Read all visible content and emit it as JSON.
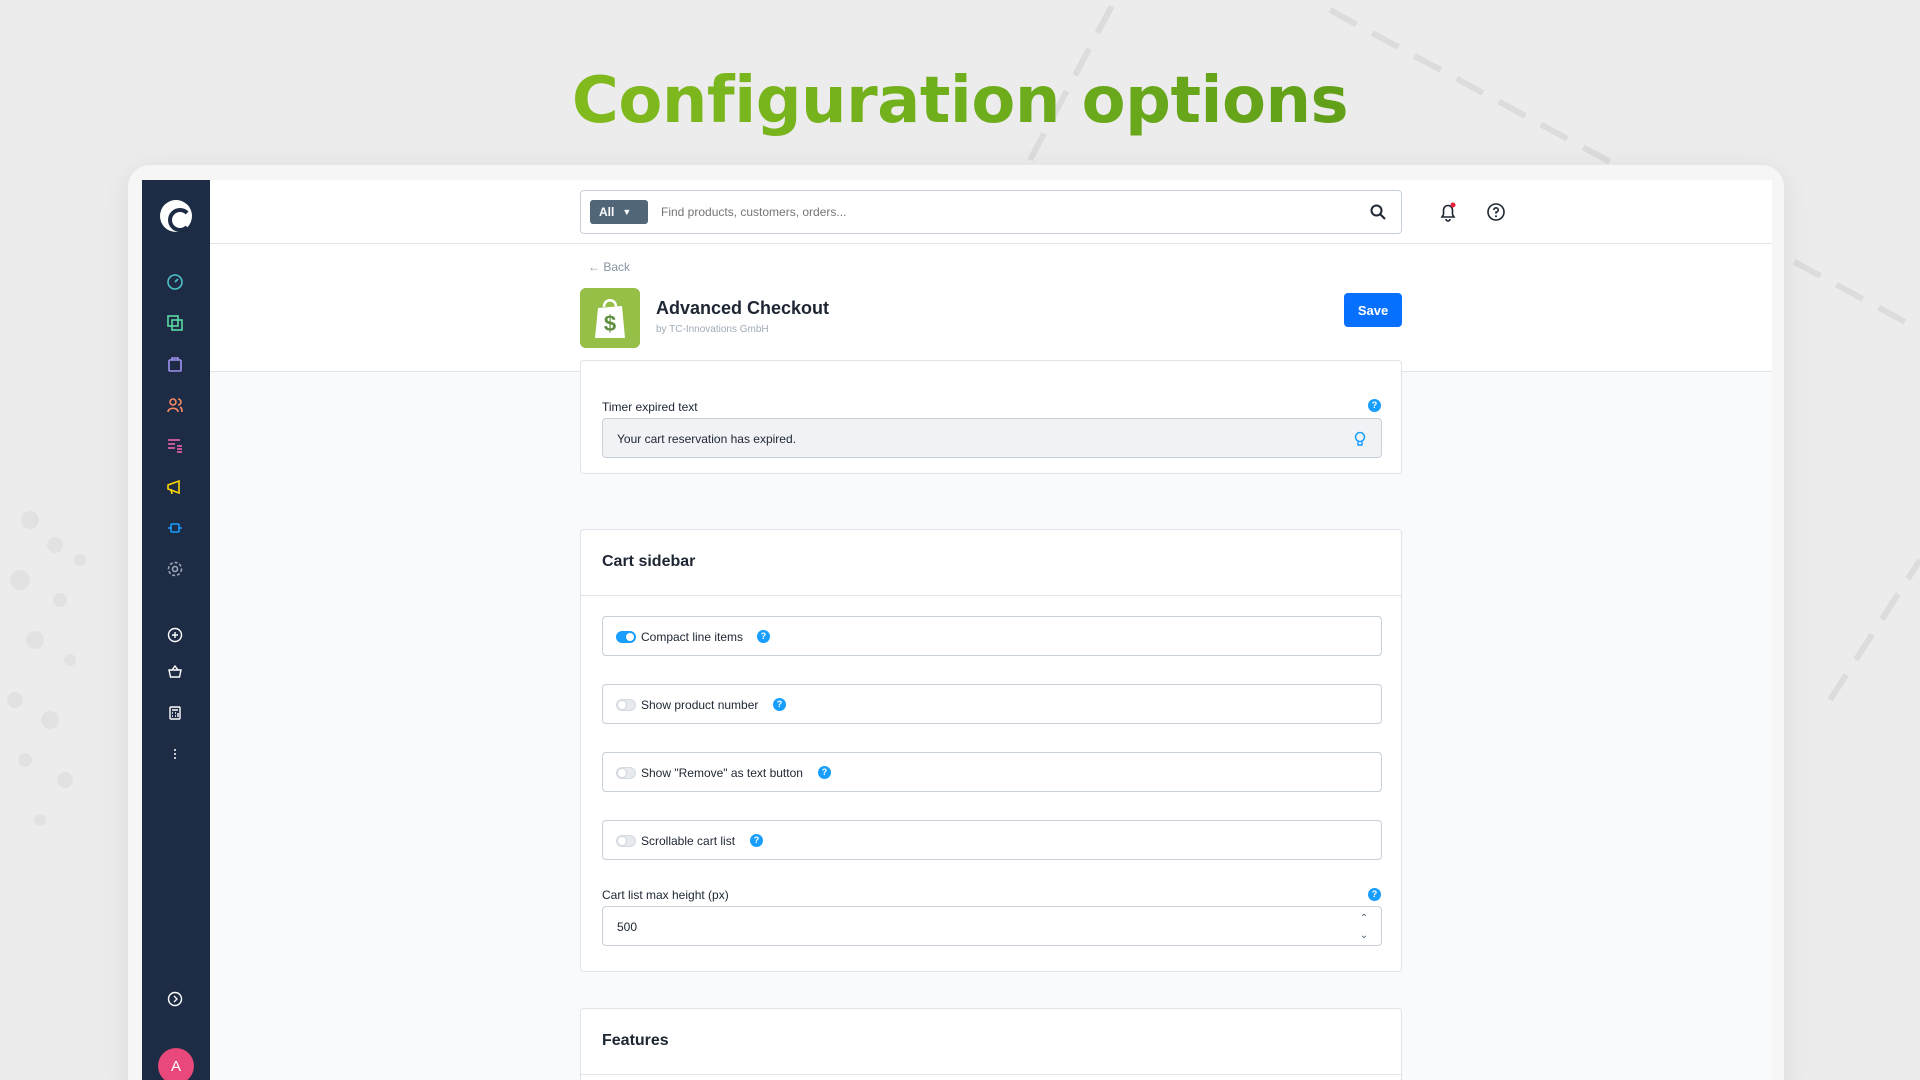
{
  "hero": {
    "title": "Configuration options"
  },
  "colors": {
    "sidebar": "#1d2b45",
    "primary": "#0870ff",
    "help": "#189eff",
    "hero_gradient": [
      "#9ccc1f",
      "#4e8a16"
    ],
    "avatar": "#e8487a"
  },
  "sidebar": {
    "items": [
      {
        "name": "dashboard-icon",
        "color": "#4fc1c8"
      },
      {
        "name": "catalogues-icon",
        "color": "#57d9a3"
      },
      {
        "name": "orders-icon",
        "color": "#a092f0"
      },
      {
        "name": "customers-icon",
        "color": "#f88962"
      },
      {
        "name": "content-icon",
        "color": "#ff68b4"
      },
      {
        "name": "marketing-icon",
        "color": "#ffd700"
      },
      {
        "name": "extensions-icon",
        "color": "#189eff"
      },
      {
        "name": "settings-icon",
        "color": "#9aa8b5"
      },
      {
        "name": "add-icon",
        "color": "#ffffff"
      },
      {
        "name": "basket-icon",
        "color": "#ffffff"
      },
      {
        "name": "calculator-icon",
        "color": "#ffffff"
      },
      {
        "name": "more-icon",
        "color": "#ffffff"
      },
      {
        "name": "expand-icon",
        "color": "#ffffff"
      }
    ],
    "avatar_initial": "A"
  },
  "search": {
    "scope": "All",
    "placeholder": "Find products, customers, orders..."
  },
  "header": {
    "back_label": "Back",
    "plugin_title": "Advanced Checkout",
    "plugin_by": "by TC-Innovations GmbH",
    "save_label": "Save"
  },
  "timer_card": {
    "label": "Timer expired text",
    "value": "Your cart reservation has expired."
  },
  "cart_sidebar": {
    "title": "Cart sidebar",
    "toggles": [
      {
        "label": "Compact line items",
        "on": true
      },
      {
        "label": "Show product number",
        "on": false
      },
      {
        "label": "Show \"Remove\" as text button",
        "on": false
      },
      {
        "label": "Scrollable cart list",
        "on": false
      }
    ],
    "max_height_label": "Cart list max height (px)",
    "max_height_value": "500"
  },
  "features": {
    "title": "Features"
  }
}
